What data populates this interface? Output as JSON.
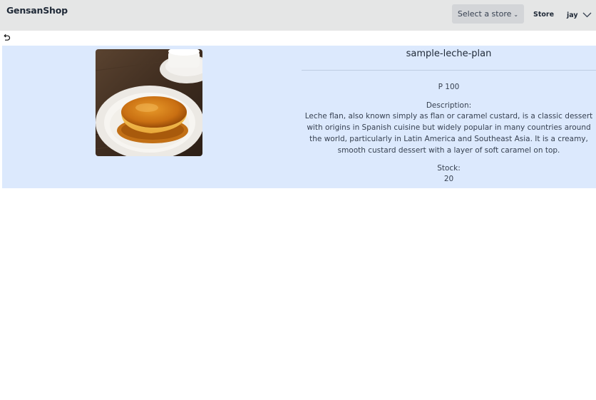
{
  "navbar": {
    "brand": "GensanShop",
    "store_select_label": "Select a store",
    "store_link": "Store",
    "username": "jay"
  },
  "product": {
    "name": "sample-leche-plan",
    "price": "P 100",
    "description_label": "Description:",
    "description": "Leche flan, also known simply as flan or caramel custard, is a classic dessert with origins in Spanish cuisine but widely popular in many countries around the world, particularly in Latin America and Southeast Asia. It is a creamy, smooth custard dessert with a layer of soft caramel on top.",
    "stock_label": "Stock:",
    "stock": "20"
  },
  "icons": {
    "back": "undo-arrow-icon",
    "store_select": "chevron-down-icon",
    "user_menu": "chevron-down-icon"
  },
  "colors": {
    "navbar_bg": "#e5e6e6",
    "panel_bg": "#dce9fd",
    "select_bg": "#d3d5d8"
  }
}
